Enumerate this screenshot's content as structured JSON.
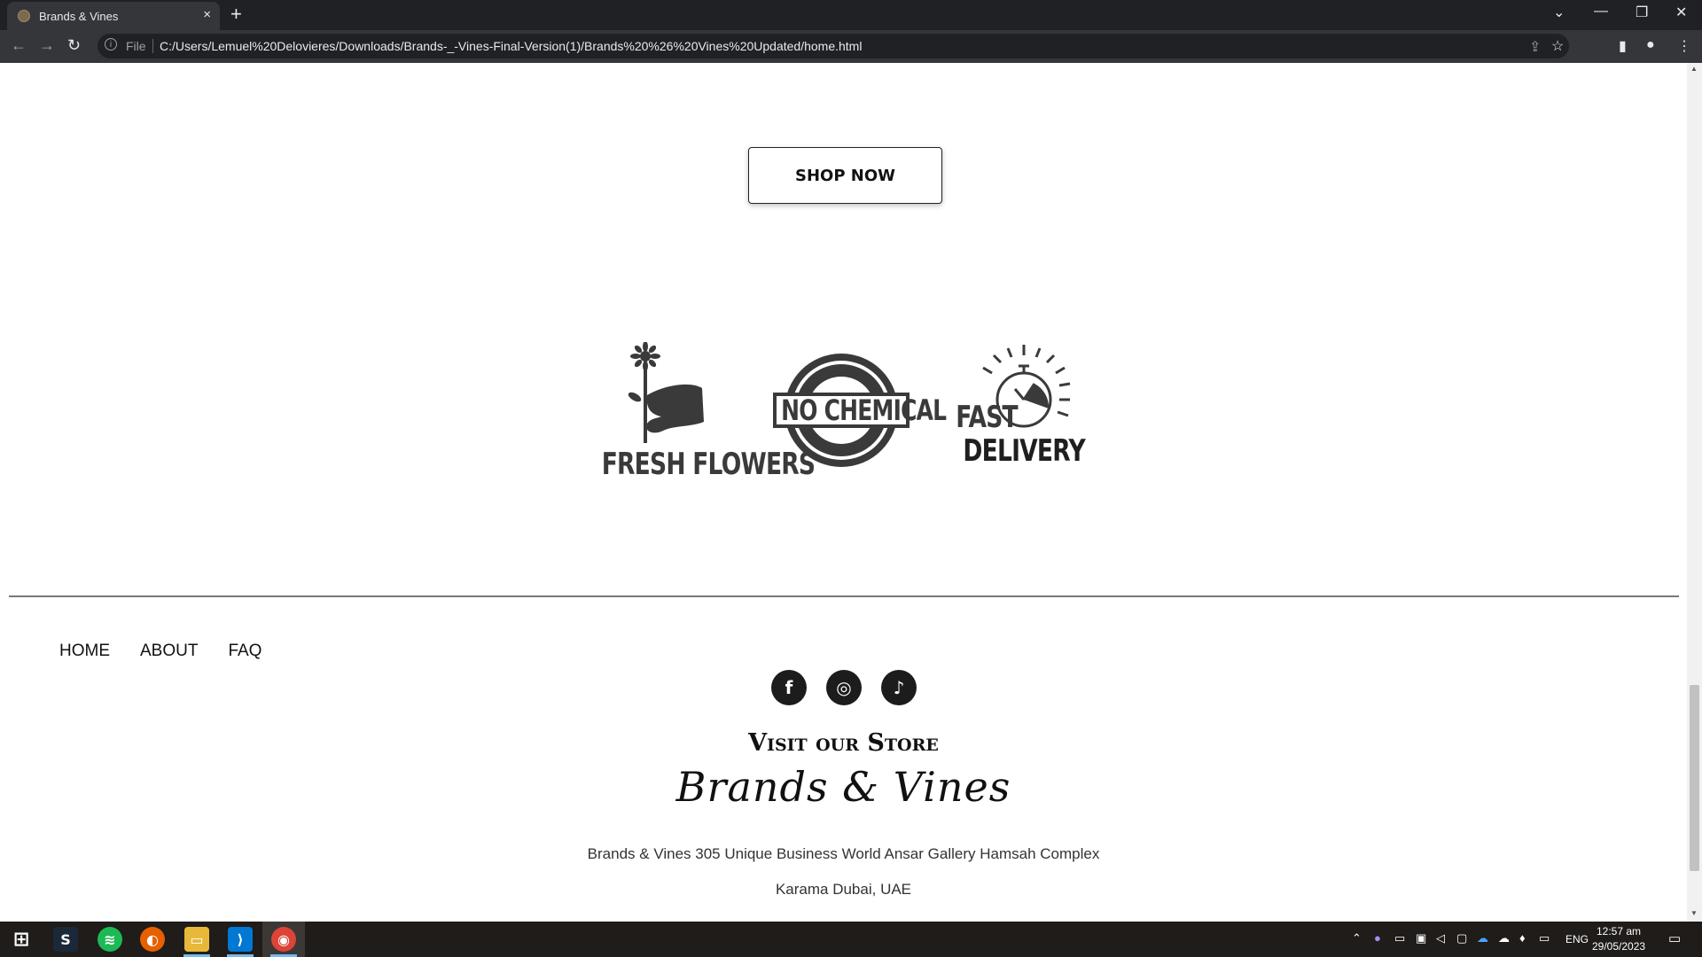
{
  "browser": {
    "tab_title": "Brands & Vines",
    "tab_close": "×",
    "new_tab": "+",
    "protocol_label": "File",
    "url": "C:/Users/Lemuel%20Delovieres/Downloads/Brands-_-Vines-Final-Version(1)/Brands%20%26%20Vines%20Updated/home.html"
  },
  "page": {
    "shop_now_label": "SHOP NOW",
    "features": [
      {
        "label": "FRESH FLOWERS",
        "icon": "flower-hand-icon"
      },
      {
        "label": "NO CHEMICAL",
        "badge_text": "NO CHEMICAL",
        "icon": "no-chemical-badge"
      },
      {
        "label_line1": "FAST",
        "label_line2": "DELIVERY",
        "icon": "stopwatch-icon"
      }
    ],
    "footer_nav": [
      "HOME",
      "ABOUT",
      "FAQ"
    ],
    "socials": [
      {
        "name": "facebook",
        "glyph": "f"
      },
      {
        "name": "instagram",
        "glyph": "◎"
      },
      {
        "name": "tiktok",
        "glyph": "♪"
      }
    ],
    "visit_title": "Visit our Store",
    "brand_script": "Brands & Vines",
    "address_line1": "Brands & Vines 305 Unique Business World Ansar Gallery Hamsah Complex",
    "address_line2": "Karama Dubai, UAE"
  },
  "taskbar": {
    "language": "ENG",
    "time": "12:57 am",
    "date": "29/05/2023"
  },
  "colors": {
    "chrome_dark": "#202124",
    "chrome_toolbar": "#35363a",
    "text_dark": "#111111",
    "icon_gray": "#3a3a3a"
  }
}
